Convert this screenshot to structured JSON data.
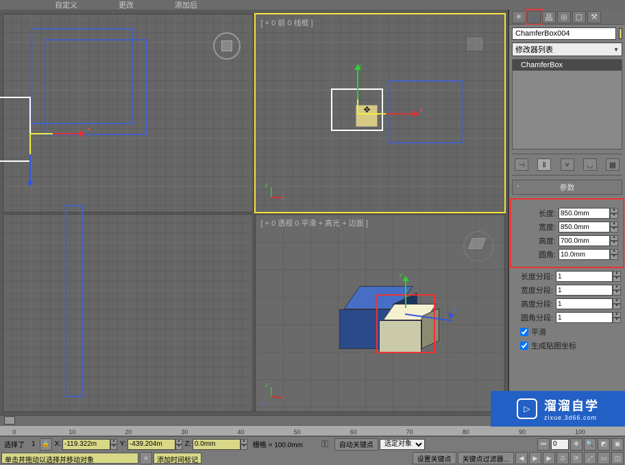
{
  "menubar": {
    "items": [
      "自定义",
      "更改",
      "添加后"
    ]
  },
  "viewports": {
    "top_left_label": "",
    "top_right_label": "[ + 0 前 0 线框 ]",
    "bottom_left_label": "",
    "bottom_right_label": "[ + 0 透视 0 平滑 + 高光 + 边面 ]"
  },
  "command_panel": {
    "object_name": "ChamferBox004",
    "modifier_list_prompt": "修改器列表",
    "stack_item": "ChamferBox",
    "rollout_title": "参数",
    "params": [
      {
        "label": "长度:",
        "value": "850.0mm",
        "highlight": true
      },
      {
        "label": "宽度:",
        "value": "850.0mm",
        "highlight": true
      },
      {
        "label": "高度:",
        "value": "700.0mm",
        "highlight": true
      },
      {
        "label": "圆角:",
        "value": "10.0mm",
        "highlight": true
      },
      {
        "label": "长度分段:",
        "value": "1"
      },
      {
        "label": "宽度分段:",
        "value": "1"
      },
      {
        "label": "高度分段:",
        "value": "1"
      },
      {
        "label": "圆角分段:",
        "value": "1"
      }
    ],
    "checks": {
      "smooth": "平滑",
      "gen_map": "生成贴图坐标"
    }
  },
  "axes": {
    "x": "x",
    "y": "y",
    "z": "z"
  },
  "timeline": {
    "ticks": [
      "0",
      "10",
      "20",
      "30",
      "40",
      "50",
      "60",
      "70",
      "80",
      "90",
      "100"
    ]
  },
  "statusbar": {
    "selected_label": "选择了",
    "selected_count": "1 ",
    "x_label": "X:",
    "x_value": "-119.322m",
    "y_label": "Y:",
    "y_value": "-439.204m",
    "z_label": "Z:",
    "z_value": "0.0mm",
    "grid_label": "栅格 = 100.0mm",
    "auto_key": "自动关键点",
    "sel_obj": "选定对象",
    "set_key": "设置关键点",
    "key_filter": "关键点过滤器...",
    "hint": "单击并拖动以选择并移动对象",
    "add_time_tag": "添加时间标记"
  },
  "watermark": {
    "big": "溜溜自学",
    "small": "zixue.3d66.com"
  },
  "chart_data": {
    "type": "table",
    "title": "ChamferBox 参数",
    "rows": [
      {
        "name": "长度",
        "value": 850.0,
        "unit": "mm"
      },
      {
        "name": "宽度",
        "value": 850.0,
        "unit": "mm"
      },
      {
        "name": "高度",
        "value": 700.0,
        "unit": "mm"
      },
      {
        "name": "圆角",
        "value": 10.0,
        "unit": "mm"
      },
      {
        "name": "长度分段",
        "value": 1
      },
      {
        "name": "宽度分段",
        "value": 1
      },
      {
        "name": "高度分段",
        "value": 1
      },
      {
        "name": "圆角分段",
        "value": 1
      }
    ]
  }
}
